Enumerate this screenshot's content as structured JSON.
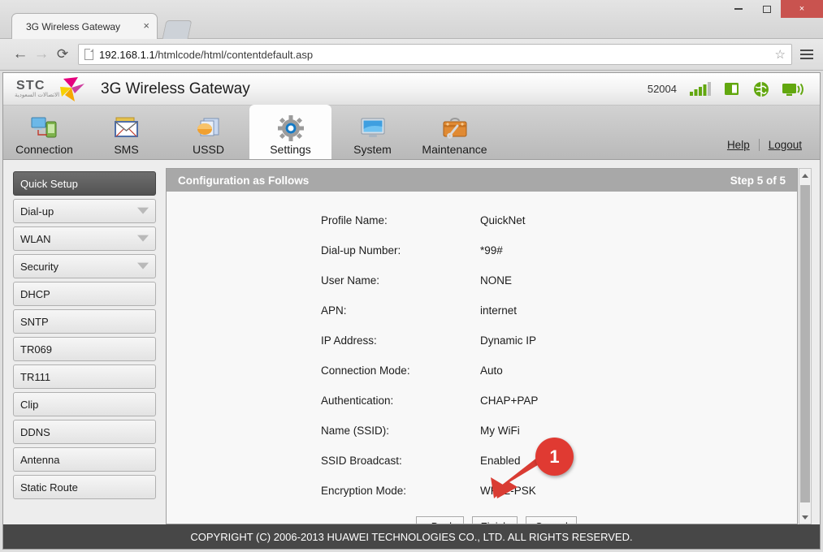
{
  "browser": {
    "tab_title": "3G Wireless Gateway",
    "tab_close": "×",
    "back_icon": "←",
    "forward_icon": "→",
    "reload_icon": "⟳",
    "url_host": "192.168.1.1",
    "url_path": "/htmlcode/html/contentdefault.asp",
    "star_icon": "☆",
    "minimize_label": "minimize",
    "maximize_label": "maximize",
    "close_label": "×"
  },
  "header": {
    "logo_text": "STC",
    "logo_sub": "الاتصالات السعودية",
    "title": "3G Wireless Gateway",
    "status_code": "52004",
    "status_icons": [
      "signal-bars-icon",
      "sim-card-icon",
      "globe-icon",
      "wifi-monitor-icon"
    ],
    "accent_green": "#62a70f",
    "accent_magenta": "#e5007d"
  },
  "nav": {
    "tabs": [
      {
        "label": "Connection",
        "icon": "connection-icon",
        "active": false
      },
      {
        "label": "SMS",
        "icon": "sms-icon",
        "active": false
      },
      {
        "label": "USSD",
        "icon": "ussd-icon",
        "active": false
      },
      {
        "label": "Settings",
        "icon": "settings-gear-icon",
        "active": true
      },
      {
        "label": "System",
        "icon": "system-monitor-icon",
        "active": false
      },
      {
        "label": "Maintenance",
        "icon": "maintenance-toolbox-icon",
        "active": false
      }
    ],
    "links": [
      {
        "label": "Help"
      },
      {
        "label": "Logout"
      }
    ]
  },
  "sidebar": {
    "items": [
      {
        "label": "Quick Setup",
        "active": true,
        "expandable": false
      },
      {
        "label": "Dial-up",
        "active": false,
        "expandable": true
      },
      {
        "label": "WLAN",
        "active": false,
        "expandable": true
      },
      {
        "label": "Security",
        "active": false,
        "expandable": true
      },
      {
        "label": "DHCP",
        "active": false,
        "expandable": false
      },
      {
        "label": "SNTP",
        "active": false,
        "expandable": false
      },
      {
        "label": "TR069",
        "active": false,
        "expandable": false
      },
      {
        "label": "TR111",
        "active": false,
        "expandable": false
      },
      {
        "label": "Clip",
        "active": false,
        "expandable": false
      },
      {
        "label": "DDNS",
        "active": false,
        "expandable": false
      },
      {
        "label": "Antenna",
        "active": false,
        "expandable": false
      },
      {
        "label": "Static Route",
        "active": false,
        "expandable": false
      }
    ]
  },
  "panel": {
    "title": "Configuration as Follows",
    "step": "Step 5 of 5",
    "rows": [
      {
        "key": "Profile Name:",
        "value": "QuickNet"
      },
      {
        "key": "Dial-up Number:",
        "value": "*99#"
      },
      {
        "key": "User Name:",
        "value": "NONE"
      },
      {
        "key": "APN:",
        "value": "internet"
      },
      {
        "key": "IP Address:",
        "value": "Dynamic IP"
      },
      {
        "key": "Connection Mode:",
        "value": "Auto"
      },
      {
        "key": "Authentication:",
        "value": "CHAP+PAP"
      },
      {
        "key": "Name (SSID):",
        "value": "My WiFi"
      },
      {
        "key": "SSID Broadcast:",
        "value": "Enabled"
      },
      {
        "key": "Encryption Mode:",
        "value": "WPA2-PSK"
      }
    ],
    "buttons": [
      {
        "label": "<Back"
      },
      {
        "label": "Finish"
      },
      {
        "label": "Cancel"
      }
    ]
  },
  "annotation": {
    "badge_number": "1",
    "badge_color": "#e03a32",
    "points_to": "Finish"
  },
  "footer": {
    "copyright": "COPYRIGHT (C) 2006-2013 HUAWEI TECHNOLOGIES CO., LTD. ALL RIGHTS RESERVED."
  }
}
